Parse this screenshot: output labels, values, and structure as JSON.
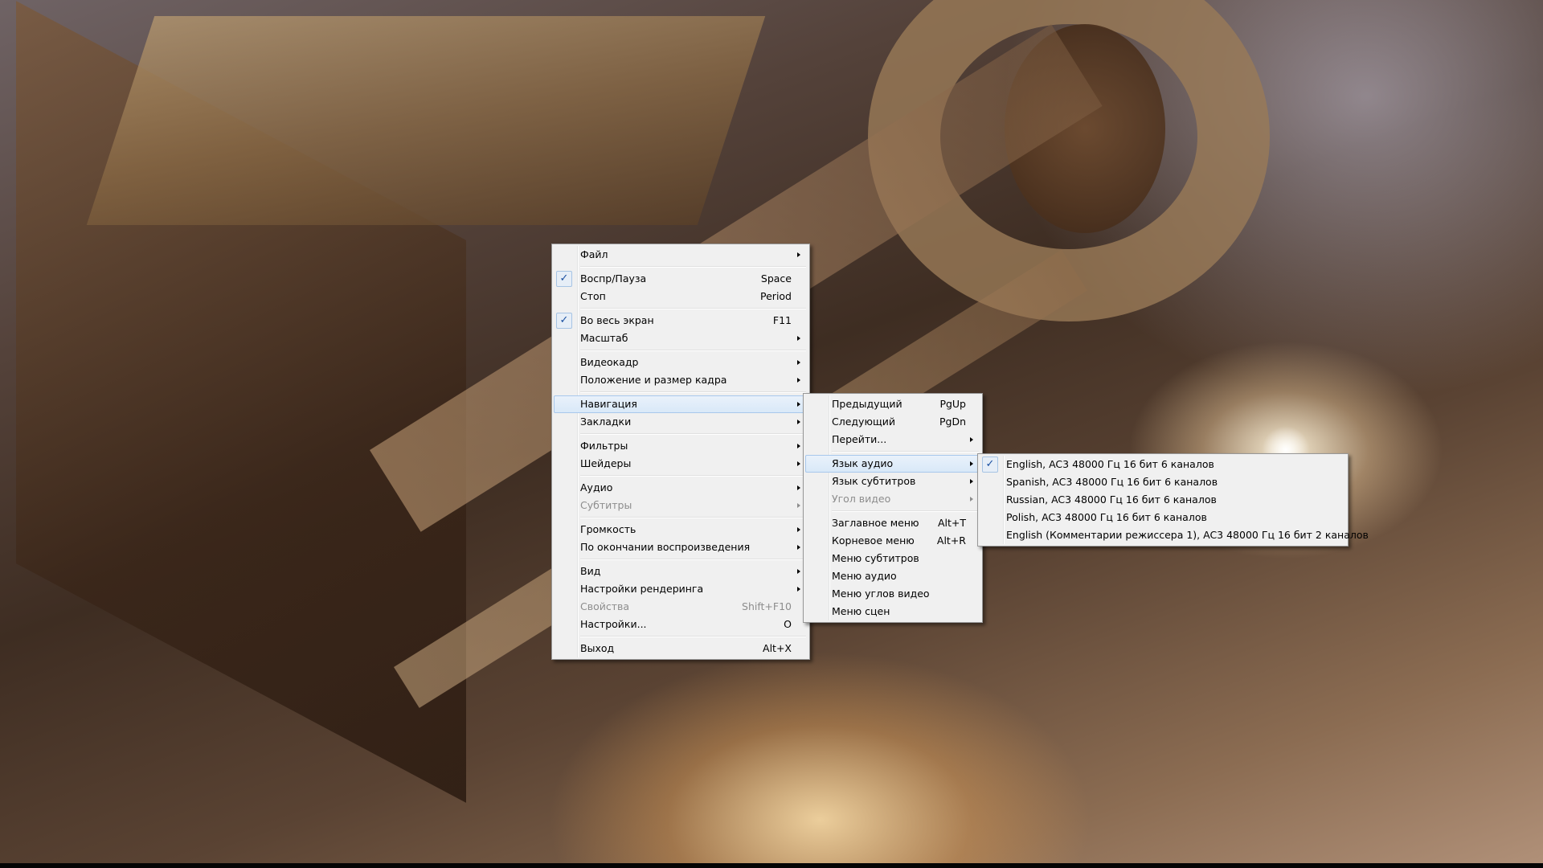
{
  "main_menu": [
    {
      "label": "Файл",
      "arrow": true
    },
    {
      "sep": true
    },
    {
      "label": "Воспр/Пауза",
      "shortcut": "Space",
      "checked": true
    },
    {
      "label": "Стоп",
      "shortcut": "Period"
    },
    {
      "sep": true
    },
    {
      "label": "Во весь экран",
      "shortcut": "F11",
      "checked": true
    },
    {
      "label": "Масштаб",
      "arrow": true
    },
    {
      "sep": true
    },
    {
      "label": "Видеокадр",
      "arrow": true
    },
    {
      "label": "Положение и размер кадра",
      "arrow": true
    },
    {
      "sep": true
    },
    {
      "label": "Навигация",
      "arrow": true,
      "highlight": true
    },
    {
      "label": "Закладки",
      "arrow": true
    },
    {
      "sep": true
    },
    {
      "label": "Фильтры",
      "arrow": true
    },
    {
      "label": "Шейдеры",
      "arrow": true
    },
    {
      "sep": true
    },
    {
      "label": "Аудио",
      "arrow": true
    },
    {
      "label": "Субтитры",
      "arrow": true,
      "disabled": true
    },
    {
      "sep": true
    },
    {
      "label": "Громкость",
      "arrow": true
    },
    {
      "label": "По окончании воспроизведения",
      "arrow": true
    },
    {
      "sep": true
    },
    {
      "label": "Вид",
      "arrow": true
    },
    {
      "label": "Настройки рендеринга",
      "arrow": true
    },
    {
      "label": "Свойства",
      "shortcut": "Shift+F10",
      "disabled": true
    },
    {
      "label": "Настройки...",
      "shortcut": "O"
    },
    {
      "sep": true
    },
    {
      "label": "Выход",
      "shortcut": "Alt+X"
    }
  ],
  "navigation_menu": [
    {
      "label": "Предыдущий",
      "shortcut": "PgUp"
    },
    {
      "label": "Следующий",
      "shortcut": "PgDn"
    },
    {
      "label": "Перейти...",
      "arrow": true
    },
    {
      "sep": true
    },
    {
      "label": "Язык аудио",
      "arrow": true,
      "highlight": true
    },
    {
      "label": "Язык субтитров",
      "arrow": true
    },
    {
      "label": "Угол видео",
      "arrow": true,
      "disabled": true
    },
    {
      "sep": true
    },
    {
      "label": "Заглавное меню",
      "shortcut": "Alt+T"
    },
    {
      "label": "Корневое меню",
      "shortcut": "Alt+R"
    },
    {
      "label": "Меню субтитров"
    },
    {
      "label": "Меню аудио"
    },
    {
      "label": "Меню углов видео"
    },
    {
      "label": "Меню сцен"
    }
  ],
  "audio_language_menu": [
    {
      "label": "English, AC3 48000 Гц 16 бит 6 каналов",
      "checked": true
    },
    {
      "label": "Spanish, AC3 48000 Гц 16 бит 6 каналов"
    },
    {
      "label": "Russian, AC3 48000 Гц 16 бит 6 каналов"
    },
    {
      "label": "Polish, AC3 48000 Гц 16 бит 6 каналов"
    },
    {
      "label": "English (Комментарии режиссера 1), AC3 48000 Гц 16 бит 2 каналов"
    }
  ],
  "colors": {
    "menu_bg": "#f0f0f0",
    "highlight": "#d8e8f8",
    "check": "#1a4fa0",
    "disabled_text": "#8d8d8d"
  }
}
